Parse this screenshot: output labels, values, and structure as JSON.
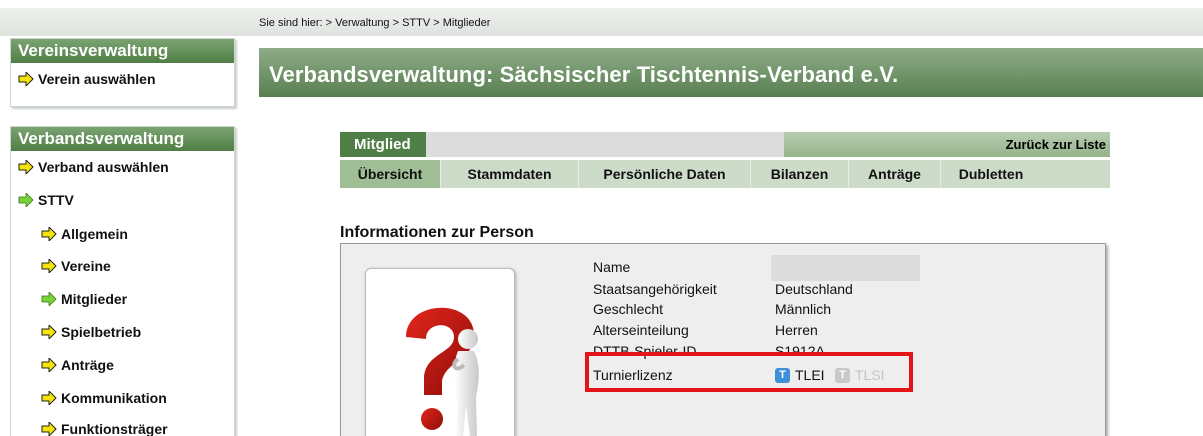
{
  "breadcrumb": "Sie sind hier: > Verwaltung > STTV > Mitglieder",
  "sidebar": {
    "verein_box": {
      "title": "Vereinsverwaltung",
      "items": [
        {
          "label": "Verein auswählen"
        }
      ]
    },
    "verband_box": {
      "title": "Verbandsverwaltung",
      "items": [
        {
          "label": "Verband auswählen"
        },
        {
          "label": "STTV"
        },
        {
          "label": "Allgemein"
        },
        {
          "label": "Vereine"
        },
        {
          "label": "Mitglieder"
        },
        {
          "label": "Spielbetrieb"
        },
        {
          "label": "Anträge"
        },
        {
          "label": "Kommunikation"
        },
        {
          "label": "Funktionsträger"
        }
      ]
    }
  },
  "header": {
    "title": "Verbandsverwaltung: Sächsischer Tischtennis-Verband e.V."
  },
  "member": {
    "label": "Mitglied",
    "back_link": "Zurück zur Liste"
  },
  "tabs": [
    {
      "label": "Übersicht"
    },
    {
      "label": "Stammdaten"
    },
    {
      "label": "Persönliche Daten"
    },
    {
      "label": "Bilanzen"
    },
    {
      "label": "Anträge"
    },
    {
      "label": "Dubletten"
    }
  ],
  "info": {
    "section_title": "Informationen zur Person",
    "fields": [
      {
        "label": "Name",
        "value": ""
      },
      {
        "label": "Staatsangehörigkeit",
        "value": "Deutschland"
      },
      {
        "label": "Geschlecht",
        "value": "Männlich"
      },
      {
        "label": "Alterseinteilung",
        "value": "Herren"
      },
      {
        "label": "DTTB-Spieler-ID",
        "value": "S1912A"
      },
      {
        "label": "Turnierlizenz",
        "value": ""
      }
    ],
    "licenses": [
      {
        "badge": "T",
        "label": "TLEI",
        "active": true
      },
      {
        "badge": "T",
        "label": "TLSI",
        "active": false
      }
    ]
  },
  "colors": {
    "green_dark": "#4f7f47",
    "green_header": "#6e9466",
    "tab_bg": "#cddcc9",
    "tab_active": "#9fbe95",
    "arrow_yellow": "#f4e409",
    "arrow_green": "#7bd13a",
    "highlight_red": "#e3141a",
    "license_active": "#3d8fd8",
    "license_inactive": "#c9c9c9"
  }
}
